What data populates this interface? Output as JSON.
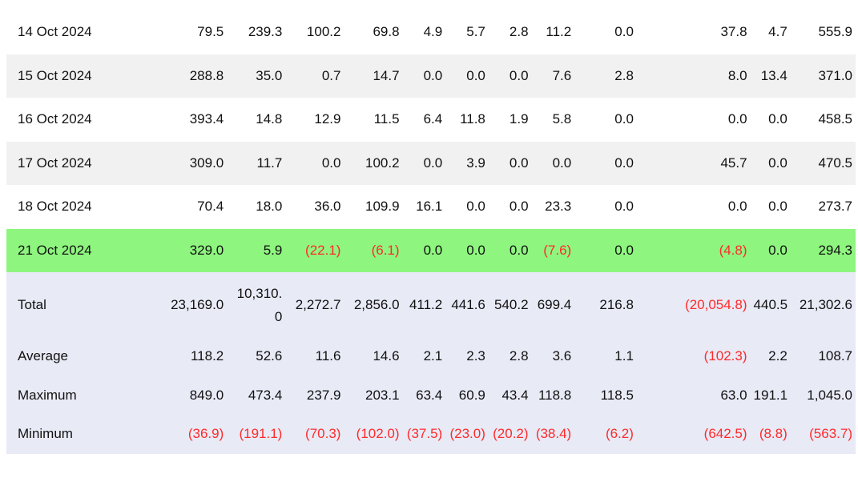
{
  "colors": {
    "highlight_row": "#8ef57f",
    "summary_bg": "#e8eaf6",
    "alt_row": "#f1f1f1",
    "negative": "#ff2a2a"
  },
  "rows": [
    {
      "date": "14 Oct 2024",
      "values": [
        "79.5",
        "239.3",
        "100.2",
        "69.8",
        "4.9",
        "5.7",
        "2.8",
        "11.2",
        "0.0",
        "37.8",
        "4.7",
        "555.9"
      ]
    },
    {
      "date": "15 Oct 2024",
      "values": [
        "288.8",
        "35.0",
        "0.7",
        "14.7",
        "0.0",
        "0.0",
        "0.0",
        "7.6",
        "2.8",
        "8.0",
        "13.4",
        "371.0"
      ]
    },
    {
      "date": "16 Oct 2024",
      "values": [
        "393.4",
        "14.8",
        "12.9",
        "11.5",
        "6.4",
        "11.8",
        "1.9",
        "5.8",
        "0.0",
        "0.0",
        "0.0",
        "458.5"
      ]
    },
    {
      "date": "17 Oct 2024",
      "values": [
        "309.0",
        "11.7",
        "0.0",
        "100.2",
        "0.0",
        "3.9",
        "0.0",
        "0.0",
        "0.0",
        "45.7",
        "0.0",
        "470.5"
      ]
    },
    {
      "date": "18 Oct 2024",
      "values": [
        "70.4",
        "18.0",
        "36.0",
        "109.9",
        "16.1",
        "0.0",
        "0.0",
        "23.3",
        "0.0",
        "0.0",
        "0.0",
        "273.7"
      ]
    },
    {
      "date": "21 Oct 2024",
      "values": [
        "329.0",
        "5.9",
        "(22.1)",
        "(6.1)",
        "0.0",
        "0.0",
        "0.0",
        "(7.6)",
        "0.0",
        "(4.8)",
        "0.0",
        "294.3"
      ]
    }
  ],
  "summary": [
    {
      "label": "Total",
      "values": [
        "23,169.0",
        "10,310.0",
        "2,272.7",
        "2,856.0",
        "411.2",
        "441.6",
        "540.2",
        "699.4",
        "216.8",
        "(20,054.8)",
        "440.5",
        "21,302.6"
      ]
    },
    {
      "label": "Average",
      "values": [
        "118.2",
        "52.6",
        "11.6",
        "14.6",
        "2.1",
        "2.3",
        "2.8",
        "3.6",
        "1.1",
        "(102.3)",
        "2.2",
        "108.7"
      ]
    },
    {
      "label": "Maximum",
      "values": [
        "849.0",
        "473.4",
        "237.9",
        "203.1",
        "63.4",
        "60.9",
        "43.4",
        "118.8",
        "118.5",
        "63.0",
        "191.1",
        "1,045.0"
      ]
    },
    {
      "label": "Minimum",
      "values": [
        "(36.9)",
        "(191.1)",
        "(70.3)",
        "(102.0)",
        "(37.5)",
        "(23.0)",
        "(20.2)",
        "(38.4)",
        "(6.2)",
        "(642.5)",
        "(8.8)",
        "(563.7)"
      ]
    }
  ]
}
